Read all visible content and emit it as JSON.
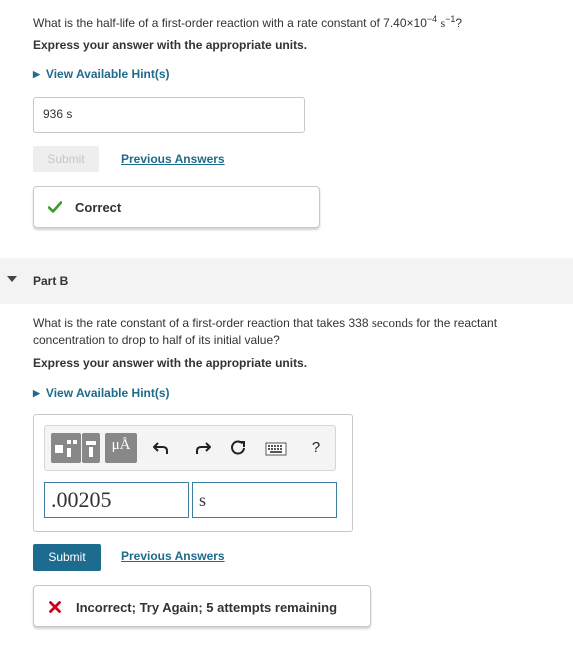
{
  "part_a": {
    "question_prefix": "What is the half-life of a first-order reaction with a rate constant of 7.40×10",
    "question_exp": "−4",
    "question_unit": "s",
    "question_unit_exp": "−1",
    "question_suffix": "?",
    "instruction": "Express your answer with the appropriate units.",
    "hint_label": "View Available Hint(s)",
    "answer_value": "936 s",
    "submit_label": "Submit",
    "previous_answers_label": "Previous Answers",
    "feedback_text": "Correct"
  },
  "part_b": {
    "title": "Part B",
    "question_before": "What is the rate constant of a first-order reaction that takes 338 ",
    "question_serif_word": "seconds",
    "question_after": " for the reactant concentration to drop to half of its initial value?",
    "instruction": "Express your answer with the appropriate units.",
    "hint_label": "View Available Hint(s)",
    "toolbar": {
      "units_label": "μÅ",
      "help_label": "?"
    },
    "value_input": ".00205",
    "unit_input": "s",
    "submit_label": "Submit",
    "previous_answers_label": "Previous Answers",
    "feedback_text": "Incorrect; Try Again; 5 attempts remaining"
  },
  "icons": {
    "correct": "checkmark-icon",
    "incorrect": "x-mark-icon",
    "undo": "undo-icon",
    "redo": "redo-icon",
    "reset": "reset-icon",
    "keyboard": "keyboard-icon"
  },
  "colors": {
    "link": "#1f6b8c",
    "submit": "#1d6c8f",
    "correct_green": "#3c9a2c",
    "incorrect_red": "#d0021b"
  }
}
